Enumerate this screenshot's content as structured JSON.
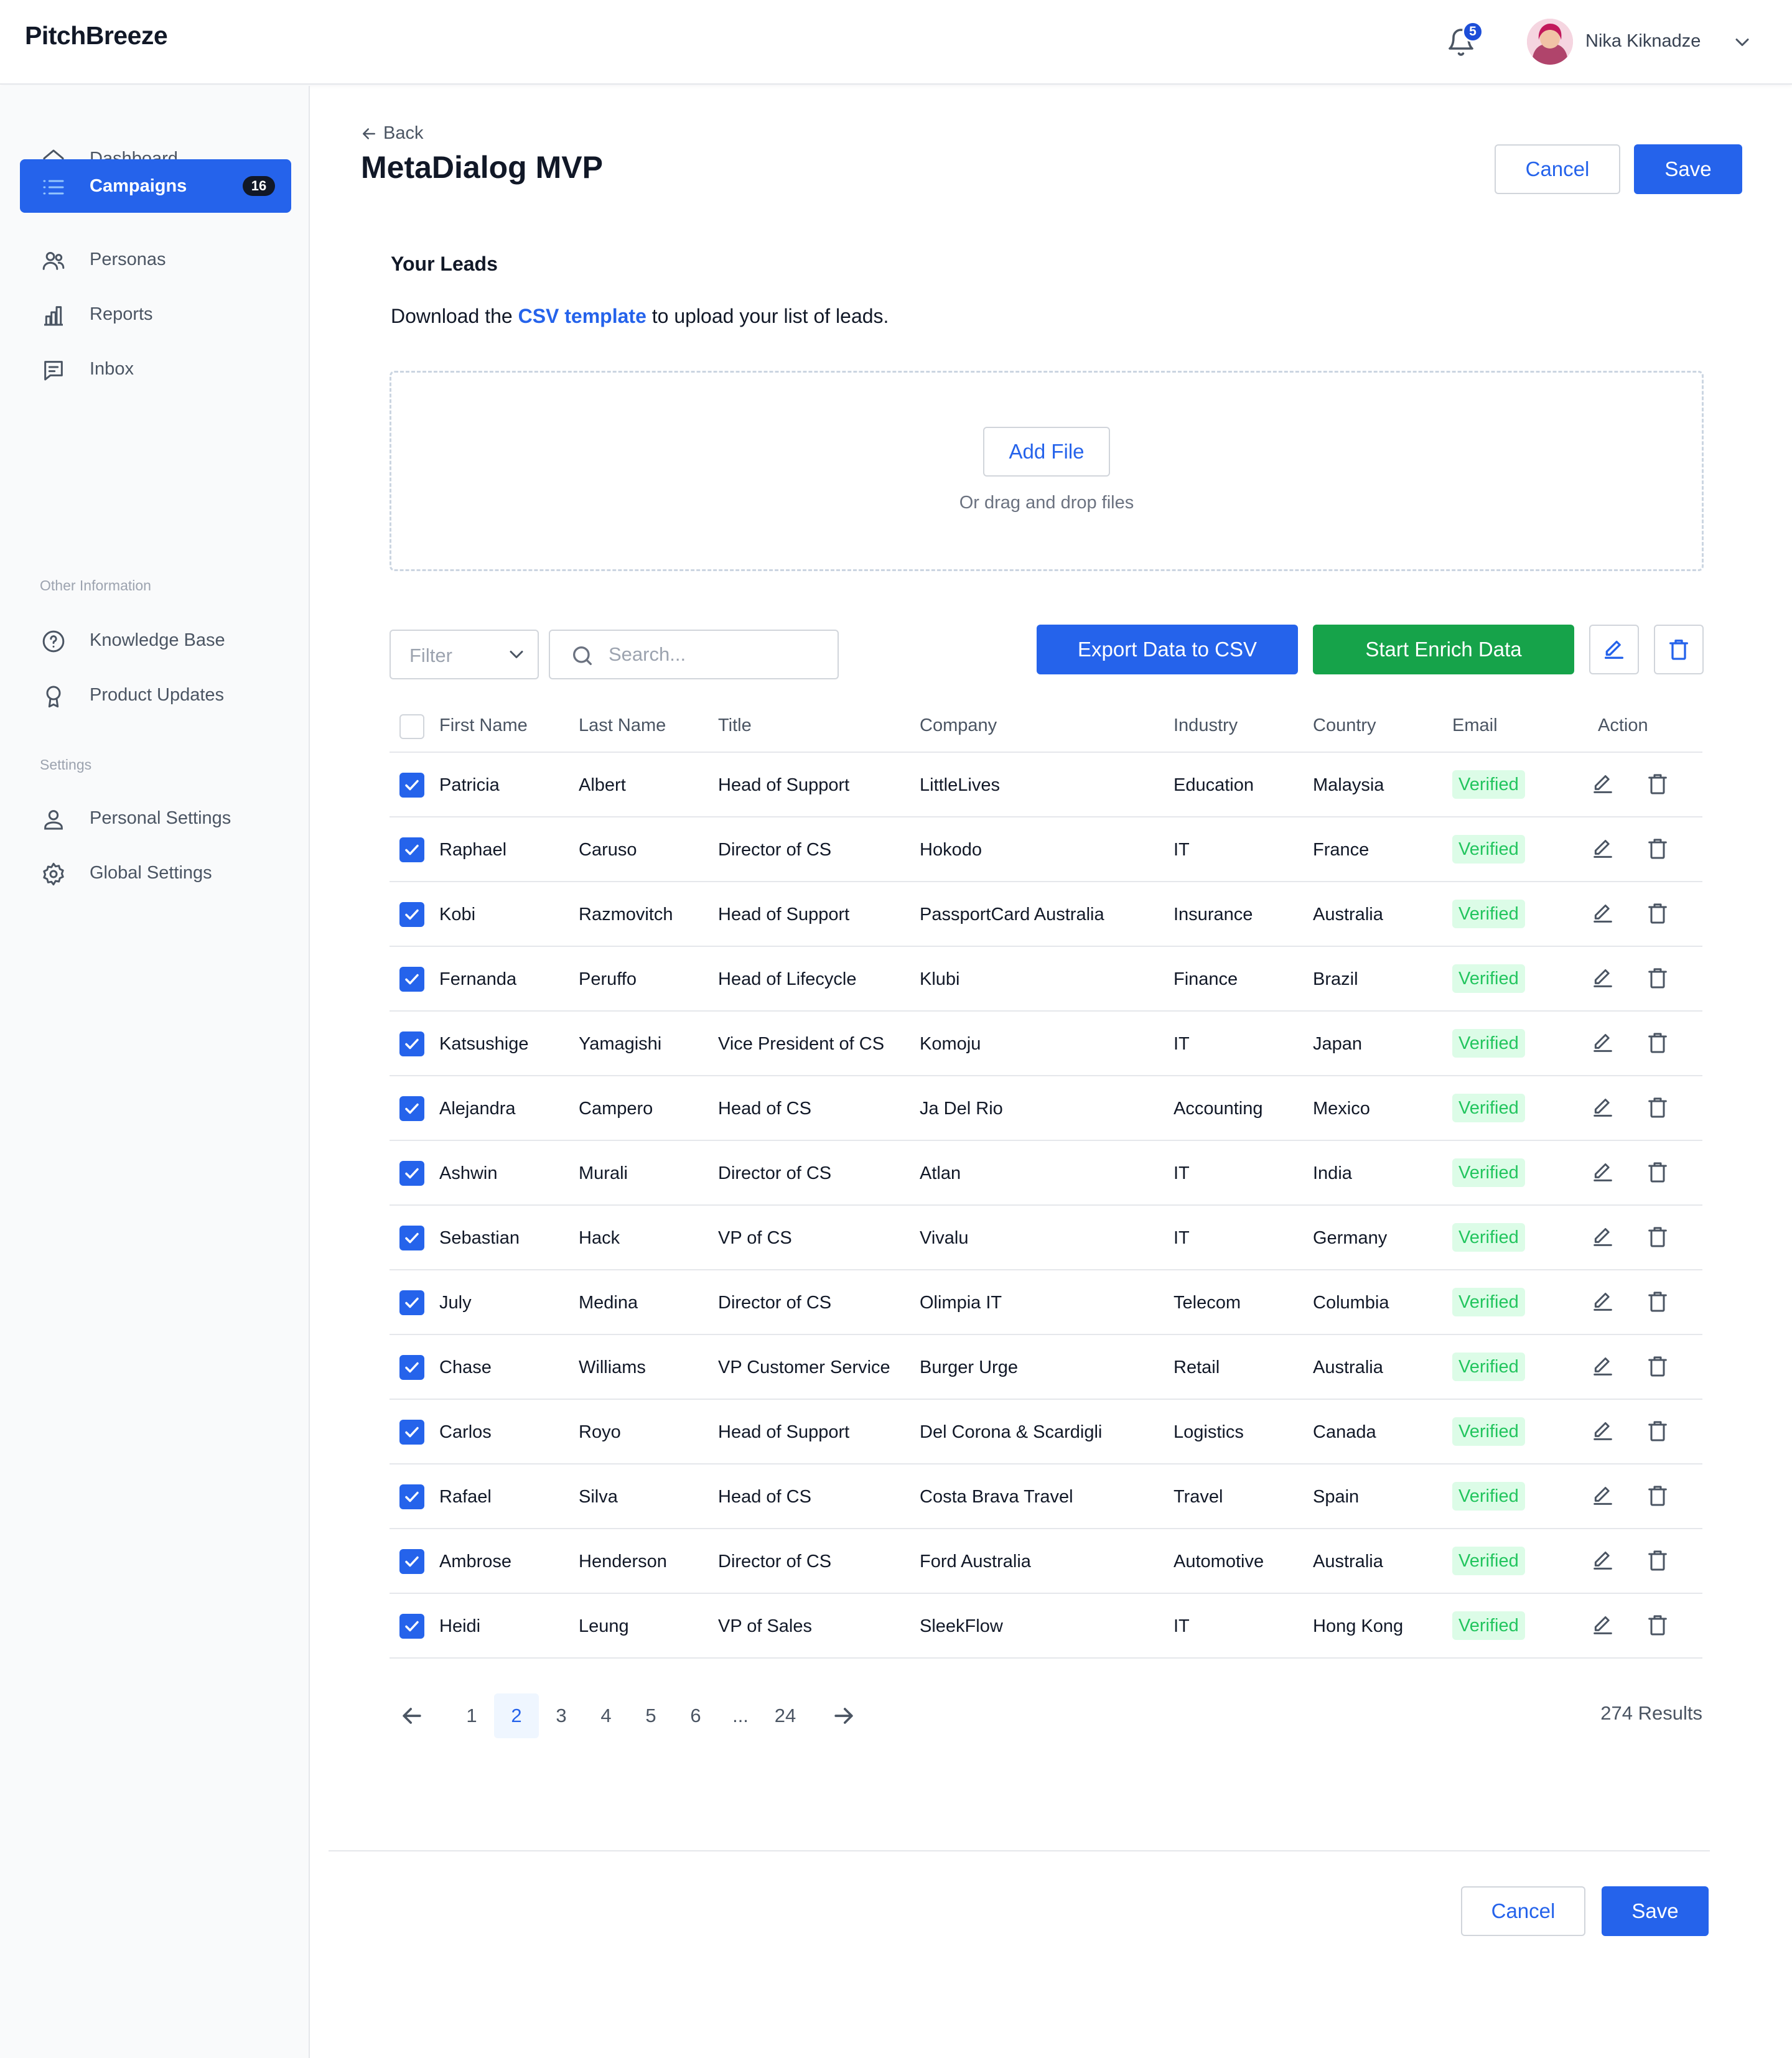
{
  "app": {
    "name": "PitchBreeze"
  },
  "user": {
    "name": "Nika Kiknadze",
    "notifications": "5"
  },
  "sidebar": {
    "items": [
      {
        "label": "Dashboard",
        "icon": "home-icon"
      },
      {
        "label": "Campaigns",
        "icon": "list-icon",
        "badge": "16",
        "active": true
      },
      {
        "label": "Personas",
        "icon": "users-icon"
      },
      {
        "label": "Reports",
        "icon": "bar-chart-icon"
      },
      {
        "label": "Inbox",
        "icon": "message-icon"
      }
    ],
    "other_title": "Other Information",
    "other_items": [
      {
        "label": "Knowledge Base",
        "icon": "help-circle-icon"
      },
      {
        "label": "Product Updates",
        "icon": "award-icon"
      }
    ],
    "settings_title": "Settings",
    "settings_items": [
      {
        "label": "Personal Settings",
        "icon": "user-icon"
      },
      {
        "label": "Global Settings",
        "icon": "gear-icon"
      }
    ]
  },
  "header": {
    "back": "Back",
    "title": "MetaDialog MVP",
    "cancel": "Cancel",
    "save": "Save"
  },
  "leads": {
    "title": "Your Leads",
    "desc_before": "Download the",
    "desc_link": "CSV template",
    "desc_after": "to upload your list of leads.",
    "add_file": "Add File",
    "drop_hint": "Or drag and drop files"
  },
  "toolbar": {
    "filter_placeholder": "Filter",
    "search_placeholder": "Search...",
    "export": "Export Data to CSV",
    "enrich": "Start Enrich Data"
  },
  "table": {
    "columns": [
      "First Name",
      "Last Name",
      "Title",
      "Company",
      "Industry",
      "Country",
      "Email",
      "Action"
    ],
    "rows": [
      {
        "first": "Patricia",
        "last": "Albert",
        "title": "Head of Support",
        "company": "LittleLives",
        "industry": "Education",
        "country": "Malaysia",
        "email": "Verified"
      },
      {
        "first": "Raphael",
        "last": "Caruso",
        "title": "Director of CS",
        "company": "Hokodo",
        "industry": "IT",
        "country": "France",
        "email": "Verified"
      },
      {
        "first": "Kobi",
        "last": "Razmovitch",
        "title": "Head of Support",
        "company": "PassportCard Australia",
        "industry": "Insurance",
        "country": "Australia",
        "email": "Verified"
      },
      {
        "first": "Fernanda",
        "last": "Peruffo",
        "title": "Head of Lifecycle",
        "company": "Klubi",
        "industry": "Finance",
        "country": "Brazil",
        "email": "Verified"
      },
      {
        "first": "Katsushige",
        "last": "Yamagishi",
        "title": "Vice President of CS",
        "company": "Komoju",
        "industry": "IT",
        "country": "Japan",
        "email": "Verified"
      },
      {
        "first": "Alejandra",
        "last": "Campero",
        "title": "Head of CS",
        "company": "Ja Del Rio",
        "industry": "Accounting",
        "country": "Mexico",
        "email": "Verified"
      },
      {
        "first": "Ashwin",
        "last": "Murali",
        "title": "Director of CS",
        "company": "Atlan",
        "industry": "IT",
        "country": "India",
        "email": "Verified"
      },
      {
        "first": "Sebastian",
        "last": "Hack",
        "title": "VP of CS",
        "company": "Vivalu",
        "industry": "IT",
        "country": "Germany",
        "email": "Verified"
      },
      {
        "first": "July",
        "last": "Medina",
        "title": "Director of CS",
        "company": "Olimpia IT",
        "industry": "Telecom",
        "country": "Columbia",
        "email": "Verified"
      },
      {
        "first": "Chase",
        "last": "Williams",
        "title": "VP Customer Service",
        "company": "Burger Urge",
        "industry": "Retail",
        "country": "Australia",
        "email": "Verified"
      },
      {
        "first": "Carlos",
        "last": "Royo",
        "title": "Head of Support",
        "company": "Del Corona & Scardigli",
        "industry": "Logistics",
        "country": "Canada",
        "email": "Verified"
      },
      {
        "first": "Rafael",
        "last": "Silva",
        "title": "Head of CS",
        "company": "Costa Brava Travel",
        "industry": "Travel",
        "country": "Spain",
        "email": "Verified"
      },
      {
        "first": "Ambrose",
        "last": "Henderson",
        "title": "Director of CS",
        "company": "Ford Australia",
        "industry": "Automotive",
        "country": "Australia",
        "email": "Verified"
      },
      {
        "first": "Heidi",
        "last": "Leung",
        "title": "VP of Sales",
        "company": "SleekFlow",
        "industry": "IT",
        "country": "Hong Kong",
        "email": "Verified"
      }
    ]
  },
  "pagination": {
    "pages": [
      "1",
      "2",
      "3",
      "4",
      "5",
      "6",
      "...",
      "24"
    ],
    "current": "2",
    "results": "274 Results"
  },
  "footer": {
    "cancel": "Cancel",
    "save": "Save"
  },
  "colors": {
    "primary": "#2563EB",
    "success": "#16A34A",
    "verified_bg": "#DCFCE7",
    "verified_text": "#22C55E"
  }
}
